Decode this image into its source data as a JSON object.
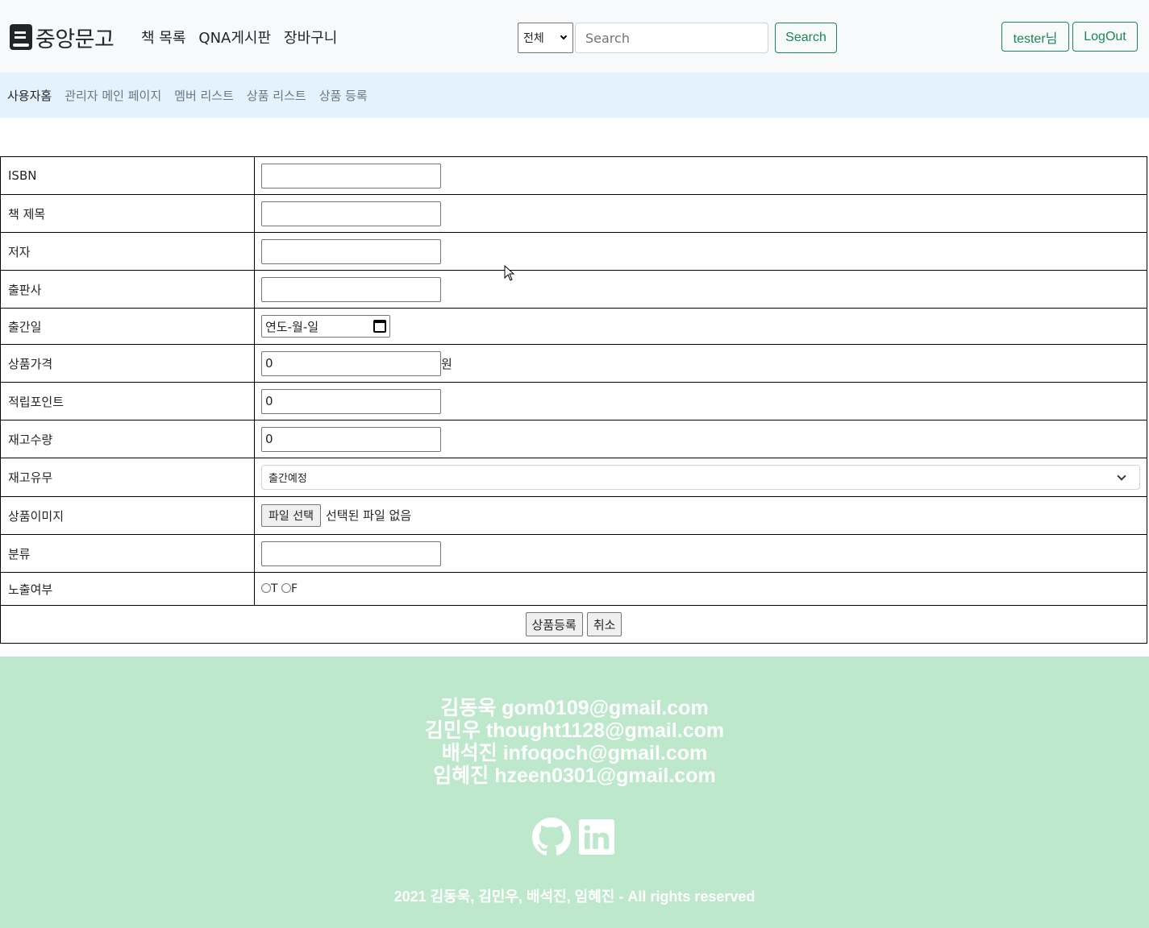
{
  "navbar": {
    "brand": "중앙문고",
    "links": [
      "책 목록",
      "QNA게시판",
      "장바구니"
    ],
    "search": {
      "select_value": "전체",
      "placeholder": "Search",
      "button": "Search"
    },
    "user_button": "tester님",
    "logout_button": "LogOut"
  },
  "subnav": {
    "items": [
      "사용자홈",
      "관리자 메인 페이지",
      "멤버 리스트",
      "상품 리스트",
      "상품 등록"
    ]
  },
  "form": {
    "isbn_label": "ISBN",
    "title_label": "책 제목",
    "author_label": "저자",
    "publisher_label": "출판사",
    "pubdate_label": "출간일",
    "pubdate_value": "연도-월-일",
    "price_label": "상품가격",
    "price_value": "0",
    "price_unit": "원",
    "point_label": "적립포인트",
    "point_value": "0",
    "qty_label": "재고수량",
    "qty_value": "0",
    "stock_label": "재고유무",
    "stock_value": "출간예정",
    "image_label": "상품이미지",
    "file_button": "파일 선택",
    "file_status": "선택된 파일 없음",
    "category_label": "분류",
    "display_label": "노출여부",
    "radio_t": "T",
    "radio_f": "F",
    "submit_button": "상품등록",
    "cancel_button": "취소"
  },
  "footer": {
    "contacts": [
      "김동욱 gom0109@gmail.com",
      "김민우 thought1128@gmail.com",
      "배석진 infoqoch@gmail.com",
      "임혜진 hzeen0301@gmail.com"
    ],
    "icons": [
      "github-icon",
      "linkedin-icon"
    ],
    "copyright": "2021 김동욱, 김민우, 배석진, 임혜진 - All rights reserved"
  },
  "colors": {
    "accent": "#198754",
    "subnav_bg": "#e3f2fd",
    "footer_bg": "#bde8cb"
  }
}
